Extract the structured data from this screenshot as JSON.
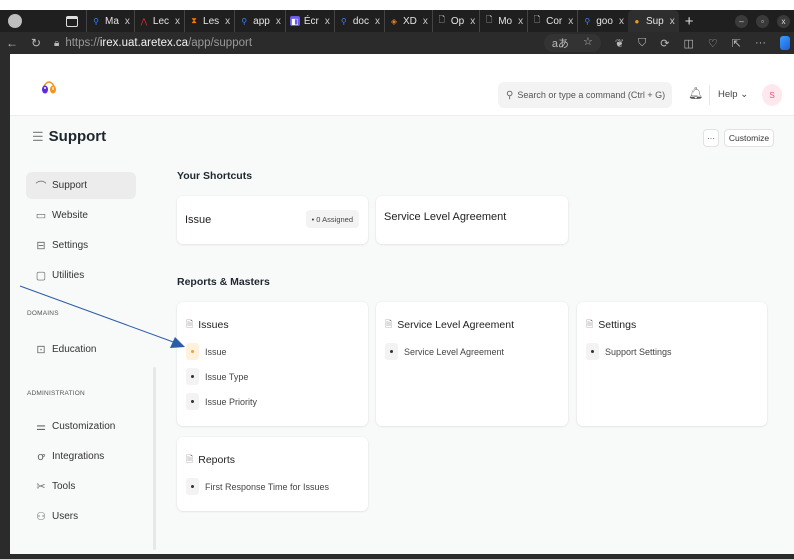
{
  "browser": {
    "tabs": [
      {
        "label": "Ma",
        "favicon": "search-icon",
        "color": "#3b82f6"
      },
      {
        "label": "Lec",
        "favicon": "adobe-icon",
        "color": "#d32f2f"
      },
      {
        "label": "Les",
        "favicon": "hourglass-icon",
        "color": "#f57c00"
      },
      {
        "label": "app",
        "favicon": "search-icon",
        "color": "#3b82f6"
      },
      {
        "label": "Écr",
        "favicon": "app-icon",
        "color": "#6c5ce7"
      },
      {
        "label": "doc",
        "favicon": "search-icon",
        "color": "#3b82f6"
      },
      {
        "label": "XD",
        "favicon": "xd-icon",
        "color": "#e67e22"
      },
      {
        "label": "Op",
        "favicon": "page-icon",
        "color": "#dddddd"
      },
      {
        "label": "Mo",
        "favicon": "page-icon",
        "color": "#dddddd"
      },
      {
        "label": "Cor",
        "favicon": "page-icon",
        "color": "#dddddd"
      },
      {
        "label": "goo",
        "favicon": "search-icon",
        "color": "#3b82f6"
      },
      {
        "label": "Sup",
        "favicon": "support-logo-icon",
        "color": "#f39c12",
        "active": true
      }
    ],
    "close_glyph": "x",
    "new_tab_glyph": "+",
    "url_prefix": "https://",
    "url_host": "irex.uat.aretex.ca",
    "url_path": "/app/support",
    "read_aloud": "aあ"
  },
  "navbar": {
    "search_placeholder": "Search or type a command (Ctrl + G)",
    "help_label": "Help",
    "avatar_initial": "S",
    "colors": {
      "logo_purple": "#5b2be0",
      "logo_orange": "#f7941d",
      "avatar_bg": "#fde8ee",
      "avatar_text": "#e8527a"
    }
  },
  "page": {
    "title": "Support",
    "more_label": "···",
    "customize_label": "Customize"
  },
  "sidebar": {
    "items": [
      {
        "label": "Support",
        "icon": "headset-icon",
        "active": true
      },
      {
        "label": "Website",
        "icon": "browser-icon"
      },
      {
        "label": "Settings",
        "icon": "server-icon"
      },
      {
        "label": "Utilities",
        "icon": "folder-icon"
      }
    ],
    "domains_label": "DOMAINS",
    "domains": [
      {
        "label": "Education",
        "icon": "book-icon"
      }
    ],
    "admin_label": "ADMINISTRATION",
    "admin": [
      {
        "label": "Customization",
        "icon": "sliders-icon"
      },
      {
        "label": "Integrations",
        "icon": "integrations-icon"
      },
      {
        "label": "Tools",
        "icon": "tools-icon"
      },
      {
        "label": "Users",
        "icon": "users-icon"
      }
    ]
  },
  "shortcuts": {
    "heading": "Your Shortcuts",
    "items": [
      {
        "label": "Issue",
        "badge": "• 0 Assigned"
      },
      {
        "label": "Service Level Agreement"
      }
    ]
  },
  "reports": {
    "heading": "Reports & Masters",
    "cards": [
      {
        "title": "Issues",
        "links": [
          "Issue",
          "Issue Type",
          "Issue Priority"
        ]
      },
      {
        "title": "Service Level Agreement",
        "links": [
          "Service Level Agreement"
        ]
      },
      {
        "title": "Settings",
        "links": [
          "Support Settings"
        ]
      },
      {
        "title": "Reports",
        "links": [
          "First Response Time for Issues"
        ]
      }
    ]
  },
  "annotation": {
    "type": "arrow",
    "color": "#2a5ca8",
    "target": "Issue"
  }
}
